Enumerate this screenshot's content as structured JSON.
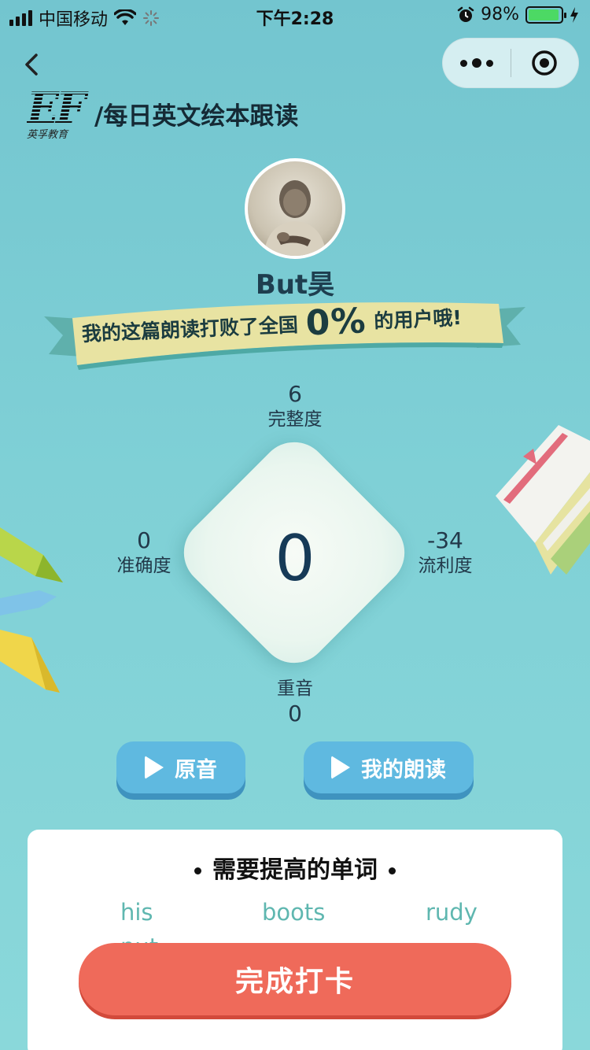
{
  "status_bar": {
    "carrier": "中国移动",
    "time": "下午2:28",
    "battery_percent": "98%",
    "battery_level": 0.98
  },
  "nav": {
    "back_icon": "chevron-left-icon",
    "more_icon": "more-dots-icon",
    "close_icon": "target-icon"
  },
  "brand": {
    "logo_text": "EF",
    "logo_subtitle": "英孚教育",
    "title": "/每日英文绘本跟读"
  },
  "profile": {
    "username": "But昊"
  },
  "banner": {
    "prefix": "我的这篇朗读打败了全国",
    "percent": "0%",
    "suffix": "的用户哦!"
  },
  "score": {
    "total": "0",
    "metrics": {
      "completeness": {
        "value": "6",
        "label": "完整度"
      },
      "accuracy": {
        "value": "0",
        "label": "准确度"
      },
      "fluency": {
        "value": "-34",
        "label": "流利度"
      },
      "stress": {
        "value": "0",
        "label": "重音"
      }
    }
  },
  "buttons": {
    "original": "原音",
    "mine": "我的朗读",
    "finish": "完成打卡"
  },
  "words_card": {
    "title": "需要提高的单词",
    "words": [
      "his",
      "boots",
      "rudy",
      "put"
    ]
  },
  "colors": {
    "background": "#7fd0d6",
    "play_button": "#5fb9e0",
    "finish_button": "#ef6a5a",
    "word_text": "#5fb7b0"
  }
}
